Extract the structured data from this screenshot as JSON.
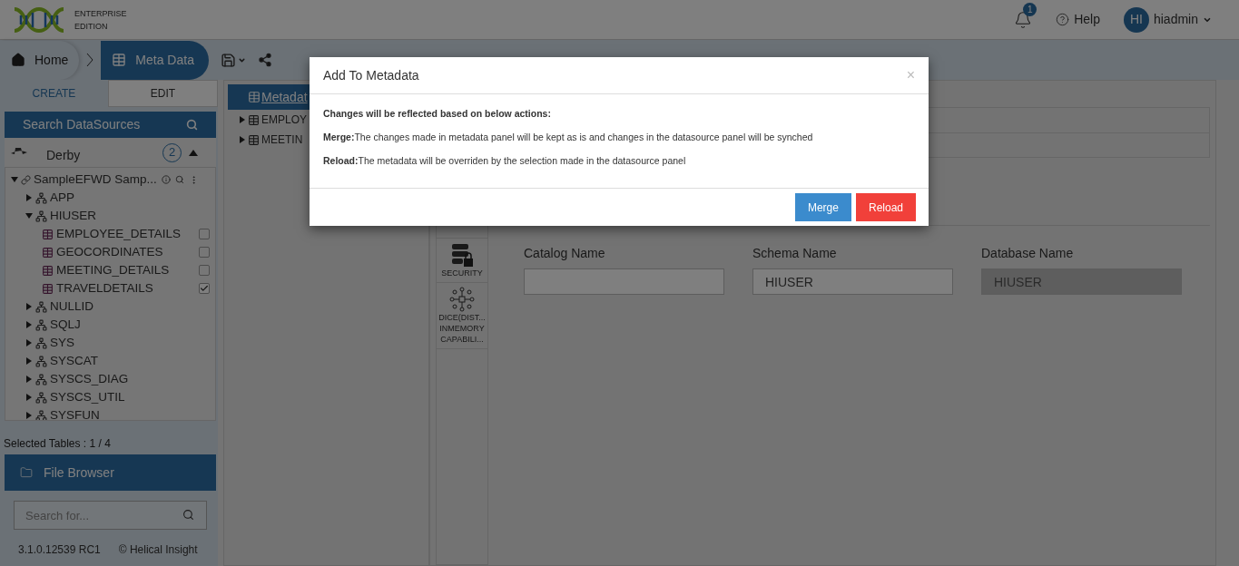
{
  "header": {
    "edition": [
      "ENTERPRISE",
      "EDITION"
    ],
    "notifications": "1",
    "help": "Help",
    "avatar": "HI",
    "user": "hiadmin"
  },
  "breadcrumb": [
    {
      "label": "Home",
      "selected": false
    },
    {
      "label": "Meta Data",
      "selected": true
    }
  ],
  "left": {
    "tabs": [
      {
        "label": "CREATE",
        "selected": false
      },
      {
        "label": "EDIT",
        "selected": true
      }
    ],
    "search": "Search DataSources",
    "datasource": {
      "name": "Derby",
      "count": "2"
    },
    "tree": [
      {
        "label": "SampleEFWD Samp...",
        "kind": "connection",
        "expanded": true,
        "children": [
          {
            "label": "APP",
            "kind": "schema",
            "expanded": false
          },
          {
            "label": "HIUSER",
            "kind": "schema",
            "expanded": true,
            "children": [
              {
                "label": "EMPLOYEE_DETAILS",
                "kind": "table",
                "checked": false
              },
              {
                "label": "GEOCORDINATES",
                "kind": "table",
                "checked": false
              },
              {
                "label": "MEETING_DETAILS",
                "kind": "table",
                "checked": false
              },
              {
                "label": "TRAVELDETAILS",
                "kind": "table",
                "checked": true
              }
            ]
          },
          {
            "label": "NULLID",
            "kind": "schema",
            "expanded": false
          },
          {
            "label": "SQLJ",
            "kind": "schema",
            "expanded": false
          },
          {
            "label": "SYS",
            "kind": "schema",
            "expanded": false
          },
          {
            "label": "SYSCAT",
            "kind": "schema",
            "expanded": false
          },
          {
            "label": "SYSCS_DIAG",
            "kind": "schema",
            "expanded": false
          },
          {
            "label": "SYSCS_UTIL",
            "kind": "schema",
            "expanded": false
          },
          {
            "label": "SYSFUN",
            "kind": "schema",
            "expanded": false
          }
        ]
      }
    ],
    "selected_tables": "Selected Tables : 1 / 4",
    "file_browser": "File Browser",
    "search_placeholder": "Search for...",
    "version": "3.1.0.12539 RC1",
    "copyright": "© Helical Insight"
  },
  "middle": {
    "tab": "Metadat",
    "items": [
      "EMPLOY",
      "MEETIN"
    ]
  },
  "right": {
    "side_items": [
      {
        "kind": "security",
        "lines": [
          "SECURITY"
        ]
      },
      {
        "kind": "dice",
        "lines": [
          "DICE(DIST...",
          "INMEMORY",
          "CAPABILI..."
        ]
      }
    ],
    "fields": [
      {
        "label": "Catalog Name",
        "disabled": false
      },
      {
        "label": "Schema Name",
        "value": "HIUSER",
        "disabled": false
      },
      {
        "label": "Database Name",
        "value": "HIUSER",
        "disabled": true
      }
    ]
  },
  "dialog": {
    "title": "Add To Metadata",
    "close": "×",
    "intro": "Changes will be reflected based on below actions:",
    "lines": [
      "**Merge:**The changes made in metadata panel will be kept as is and changes in the datasource panel will be synched",
      "**Reload:**The metadata will be overriden by the selection made in the datasource panel"
    ],
    "buttons": [
      {
        "label": "Merge",
        "kind": "primary"
      },
      {
        "label": "Reload",
        "kind": "danger"
      }
    ]
  }
}
